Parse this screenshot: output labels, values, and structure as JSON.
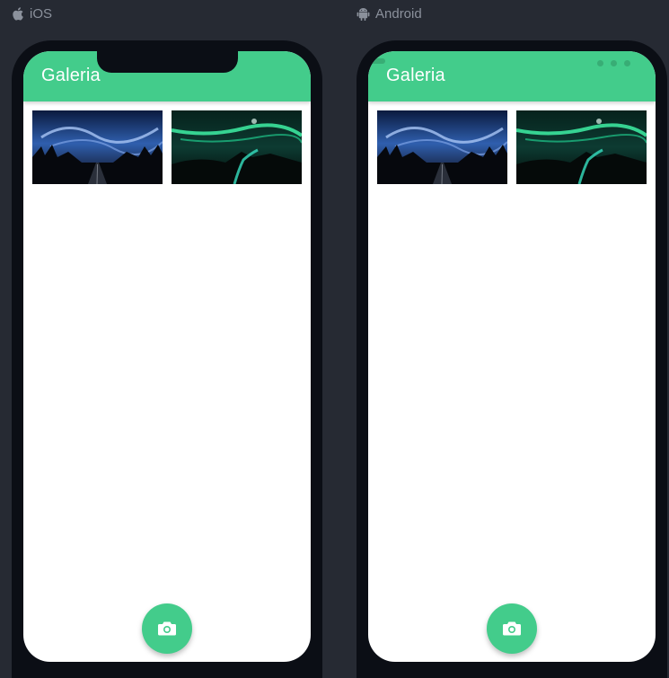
{
  "platforms": {
    "ios": {
      "label": "iOS",
      "icon": "apple-icon"
    },
    "android": {
      "label": "Android",
      "icon": "android-icon"
    }
  },
  "app": {
    "title": "Galeria",
    "accent_color": "#43cc8b",
    "fab_icon": "camera-icon"
  },
  "gallery": {
    "photos": [
      {
        "subject": "night-road-sky",
        "icon": "photo-thumbnail"
      },
      {
        "subject": "aurora-coast",
        "icon": "photo-thumbnail"
      }
    ]
  }
}
